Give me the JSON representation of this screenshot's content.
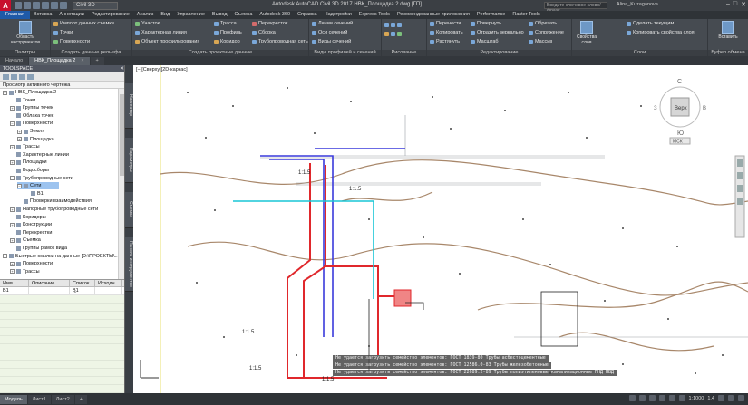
{
  "titlebar": {
    "logo": "A",
    "workspace": "Civil 3D",
    "title": "Autodesk AutoCAD Civil 3D 2017   НВК_Площадка 2.dwg [ГП]",
    "search_placeholder": "Введите ключевое слово/фразу",
    "user": "Alina_Kuzaganova"
  },
  "ribbon_tabs": [
    "Главная",
    "Вставка",
    "Аннотации",
    "Редактирование",
    "Анализ",
    "Вид",
    "Управление",
    "Вывод",
    "Съемка",
    "Autodesk 360",
    "Справка",
    "Надстройки",
    "Express Tools",
    "Рекомендованные приложения",
    "Performance",
    "Raster Tools"
  ],
  "ribbon": {
    "toolspace_btn": "Область инструментов",
    "panel_palettes": "Палитры",
    "panel_ground": "Создать данные рельефа",
    "ground_rows": [
      "Импорт данных съемки",
      "Точки",
      "Поверхности"
    ],
    "panel_design": "Создать проектные данные",
    "design_rows_a": [
      "Участок",
      "Характерная линия",
      "Объект профилирования"
    ],
    "design_rows_b": [
      "Трасса",
      "Профиль",
      "Коридор"
    ],
    "design_rows_c": [
      "Перекресток",
      "Сборка",
      "Трубопроводная сеть"
    ],
    "panel_views": "Виды профилей и сечений",
    "views_rows": [
      "Линии сечений",
      "Оси сечений",
      "Виды сечений",
      "Вид профилей",
      "Вид врезок",
      "Виды сечений"
    ],
    "panel_draw": "Рисование",
    "panel_modify": "Редактирование",
    "modify_rows": [
      "Перенести",
      "Копировать",
      "Растянуть",
      "Повернуть",
      "Отразить зеркально",
      "Масштаб",
      "Обрезать",
      "Сопряжение",
      "Массив"
    ],
    "panel_layers": "Слои",
    "layer_rows": [
      "Свойства слоя",
      "Сделать текущим",
      "Копировать свойства слоя"
    ],
    "paste_btn": "Вставить",
    "panel_clipboard": "Буфер обмена"
  },
  "doc_tabs": [
    {
      "label": "Начало",
      "active": false
    },
    {
      "label": "НВК_Площадка 2",
      "active": true
    }
  ],
  "toolspace": {
    "header": "TOOLSPACE",
    "view": "Просмотр активного чертежа",
    "tree": [
      {
        "label": "НВК_Площадка 2",
        "level": 0,
        "exp": "−"
      },
      {
        "label": "Точки",
        "level": 1,
        "exp": ""
      },
      {
        "label": "Группы точек",
        "level": 1,
        "exp": "+"
      },
      {
        "label": "Облака точек",
        "level": 1,
        "exp": ""
      },
      {
        "label": "Поверхности",
        "level": 1,
        "exp": "−"
      },
      {
        "label": "Земля",
        "level": 2,
        "exp": "+"
      },
      {
        "label": "Площадка",
        "level": 2,
        "exp": "+"
      },
      {
        "label": "Трассы",
        "level": 1,
        "exp": "+"
      },
      {
        "label": "Характерные линии",
        "level": 1,
        "exp": ""
      },
      {
        "label": "Площадки",
        "level": 1,
        "exp": "+"
      },
      {
        "label": "Водосборы",
        "level": 1,
        "exp": ""
      },
      {
        "label": "Трубопроводные сети",
        "level": 1,
        "exp": "−"
      },
      {
        "label": "Сети",
        "level": 2,
        "exp": "−",
        "selected": true
      },
      {
        "label": "В1",
        "level": 3,
        "exp": ""
      },
      {
        "label": "Проверки взаимодействия",
        "level": 2,
        "exp": ""
      },
      {
        "label": "Напорные трубопроводные сети",
        "level": 1,
        "exp": "+"
      },
      {
        "label": "Коридоры",
        "level": 1,
        "exp": ""
      },
      {
        "label": "Конструкции",
        "level": 1,
        "exp": "+"
      },
      {
        "label": "Перекрестки",
        "level": 1,
        "exp": ""
      },
      {
        "label": "Съемка",
        "level": 1,
        "exp": "+"
      },
      {
        "label": "Группы рамок вида",
        "level": 1,
        "exp": ""
      },
      {
        "label": "Быстрые ссылки на данные [D:\\ПРОЕКТЫ\\...",
        "level": 0,
        "exp": "−"
      },
      {
        "label": "Поверхности",
        "level": 1,
        "exp": "+"
      },
      {
        "label": "Трассы",
        "level": 1,
        "exp": "+"
      }
    ],
    "props_cols": [
      "Имя",
      "Описание",
      "Список ...",
      "Исходн"
    ],
    "props_row": [
      "В1",
      "",
      "В1",
      ""
    ]
  },
  "vtabs": [
    "Навигатор",
    "Параметры",
    "Съемка",
    "Панель инструментов"
  ],
  "canvas": {
    "view_label": "[−][Сверху][2D-каркас]",
    "viewcube": {
      "top": "С",
      "center": "Верх",
      "bottom": "Ю",
      "west": "З",
      "east": "В",
      "ucs": "МСК"
    },
    "slope_labels": [
      "1:1.5",
      "1:1.5",
      "1:1.5",
      "1:1.5",
      "1:1.5"
    ],
    "warnings": [
      "Не удается загрузить семейство элементов: ГОСТ 1839-80 Трубы асбестоцементные",
      "Не удается загрузить семейство элементов: ГОСТ 12586.0-83 Трубы железобетонные",
      "Не удается загрузить семейство элементов: ГОСТ 22689.2-89 Трубы полиэтиленовые канализационные ПНД ПВД"
    ]
  },
  "status": {
    "layouts": [
      {
        "label": "Модель",
        "active": true
      },
      {
        "label": "Лист1",
        "active": false
      },
      {
        "label": "Лист2",
        "active": false
      }
    ],
    "scale": "1:1000",
    "value": "1.4"
  },
  "colors": {
    "accent": "#1e5aa8",
    "pipe_red": "#e0282c",
    "pipe_blue": "#3a3adb",
    "contour": "#a8876a",
    "cyan": "#19c6d6"
  }
}
